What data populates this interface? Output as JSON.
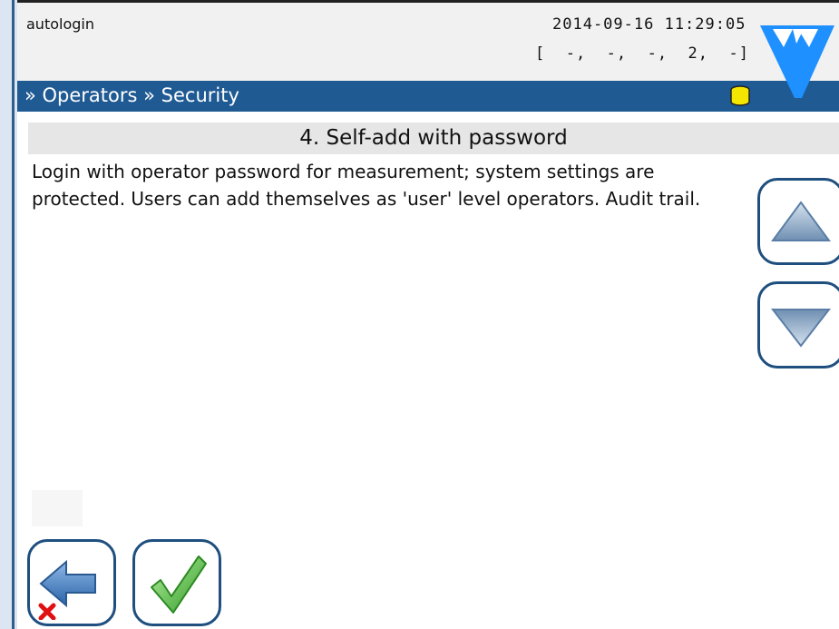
{
  "status": {
    "username": "autologin",
    "datetime": "2014-09-16 11:29:05",
    "indicators": "[  -,  -,  -,  2,  -]"
  },
  "titlebar": {
    "breadcrumb": "» Operators » Security"
  },
  "page": {
    "heading": "4. Self-add with password",
    "description": "Login with operator password for measurement; system settings are protected. Users can add themselves as 'user' level operators. Audit trail."
  },
  "colors": {
    "titlebar": "#1f5a93",
    "button_border": "#1f4f7f",
    "logo": "#1e90ff",
    "database_icon": "#f5e600",
    "ok_check": "#4cc43a",
    "cancel_x": "#e01010"
  },
  "icons": {
    "logo": "brand-logo-icon",
    "database": "database-icon",
    "up": "arrow-up-icon",
    "down": "arrow-down-icon",
    "back": "back-cancel-icon",
    "ok": "checkmark-icon"
  }
}
